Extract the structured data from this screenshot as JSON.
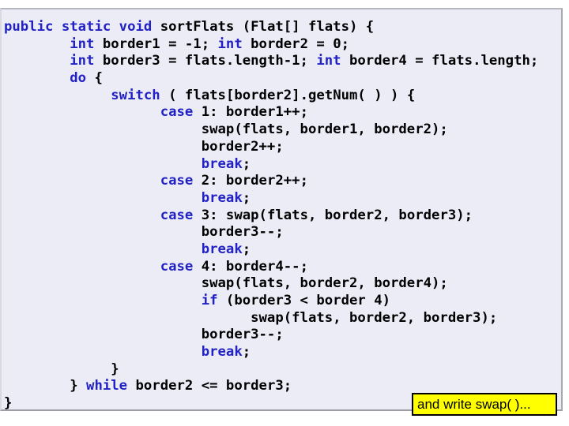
{
  "slide": {
    "background_color": "#ececf7",
    "frame_border_color": "#a8a8b0"
  },
  "code_block": {
    "language": "java",
    "keyword_color": "#2222c4",
    "text_color": "#000000",
    "lines": [
      [
        {
          "t": "public static void ",
          "k": true
        },
        {
          "t": "sortFlats (Flat[] flats) {",
          "k": false
        }
      ],
      [
        {
          "t": "        ",
          "k": false
        },
        {
          "t": "int ",
          "k": true
        },
        {
          "t": "border1 = -1; ",
          "k": false
        },
        {
          "t": "int ",
          "k": true
        },
        {
          "t": "border2 = 0;",
          "k": false
        }
      ],
      [
        {
          "t": "        ",
          "k": false
        },
        {
          "t": "int ",
          "k": true
        },
        {
          "t": "border3 = flats.length-1; ",
          "k": false
        },
        {
          "t": "int ",
          "k": true
        },
        {
          "t": "border4 = flats.length;",
          "k": false
        }
      ],
      [
        {
          "t": "        ",
          "k": false
        },
        {
          "t": "do ",
          "k": true
        },
        {
          "t": "{",
          "k": false
        }
      ],
      [
        {
          "t": "             ",
          "k": false
        },
        {
          "t": "switch ",
          "k": true
        },
        {
          "t": "( flats[border2].getNum( ) ) {",
          "k": false
        }
      ],
      [
        {
          "t": "                   ",
          "k": false
        },
        {
          "t": "case ",
          "k": true
        },
        {
          "t": "1: border1++;",
          "k": false
        }
      ],
      [
        {
          "t": "                        swap(flats, border1, border2);",
          "k": false
        }
      ],
      [
        {
          "t": "                        border2++;",
          "k": false
        }
      ],
      [
        {
          "t": "                        ",
          "k": false
        },
        {
          "t": "break",
          "k": true
        },
        {
          "t": ";",
          "k": false
        }
      ],
      [
        {
          "t": "                   ",
          "k": false
        },
        {
          "t": "case ",
          "k": true
        },
        {
          "t": "2: border2++;",
          "k": false
        }
      ],
      [
        {
          "t": "                        ",
          "k": false
        },
        {
          "t": "break",
          "k": true
        },
        {
          "t": ";",
          "k": false
        }
      ],
      [
        {
          "t": "                   ",
          "k": false
        },
        {
          "t": "case ",
          "k": true
        },
        {
          "t": "3: swap(flats, border2, border3);",
          "k": false
        }
      ],
      [
        {
          "t": "                        border3--;",
          "k": false
        }
      ],
      [
        {
          "t": "                        ",
          "k": false
        },
        {
          "t": "break",
          "k": true
        },
        {
          "t": ";",
          "k": false
        }
      ],
      [
        {
          "t": "                   ",
          "k": false
        },
        {
          "t": "case ",
          "k": true
        },
        {
          "t": "4: border4--;",
          "k": false
        }
      ],
      [
        {
          "t": "                        swap(flats, border2, border4);",
          "k": false
        }
      ],
      [
        {
          "t": "                        ",
          "k": false
        },
        {
          "t": "if ",
          "k": true
        },
        {
          "t": "(border3 < border 4)",
          "k": false
        }
      ],
      [
        {
          "t": "                              swap(flats, border2, border3);",
          "k": false
        }
      ],
      [
        {
          "t": "                        border3--;",
          "k": false
        }
      ],
      [
        {
          "t": "                        ",
          "k": false
        },
        {
          "t": "break",
          "k": true
        },
        {
          "t": ";",
          "k": false
        }
      ],
      [
        {
          "t": "             }",
          "k": false
        }
      ],
      [
        {
          "t": "        } ",
          "k": false
        },
        {
          "t": "while ",
          "k": true
        },
        {
          "t": "border2 <= border3;",
          "k": false
        }
      ],
      [
        {
          "t": "}",
          "k": false
        }
      ]
    ]
  },
  "callout": {
    "text": "and write swap( )...",
    "background_color": "#ffff00",
    "border_color": "#000000",
    "text_color": "#000000"
  }
}
